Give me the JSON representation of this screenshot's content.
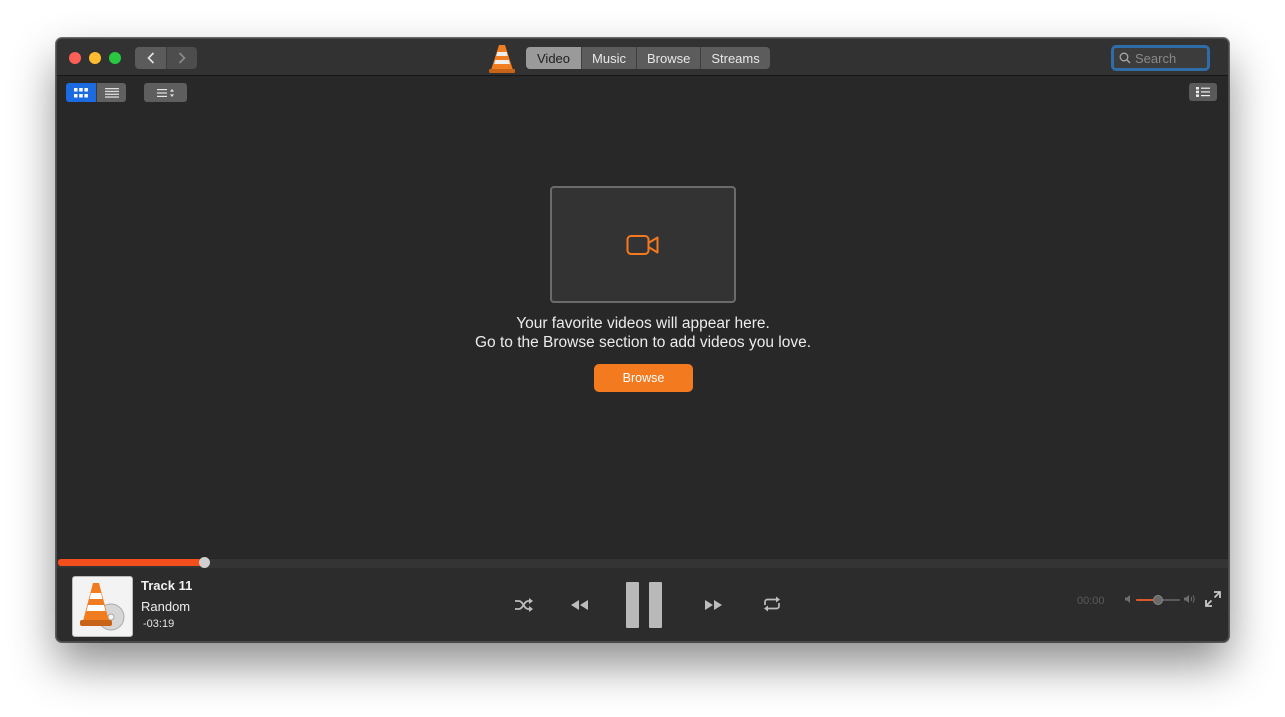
{
  "titlebar": {
    "tabs": [
      {
        "label": "Video",
        "active": true
      },
      {
        "label": "Music",
        "active": false
      },
      {
        "label": "Browse",
        "active": false
      },
      {
        "label": "Streams",
        "active": false
      }
    ],
    "search_placeholder": "Search"
  },
  "library": {
    "view_mode": "grid",
    "empty_message_line1": "Your favorite videos will appear here.",
    "empty_message_line2": "Go to the Browse section to add videos you love.",
    "browse_button_label": "Browse",
    "placeholder_icon": "video-camera-icon"
  },
  "player": {
    "track_title": "Track 11",
    "artist": "Random",
    "remaining_time": "-03:19",
    "elapsed_time": "00:00",
    "progress_fraction": 0.125,
    "volume_fraction": 0.5,
    "state": "playing"
  },
  "colors": {
    "accent": "#f47a1f",
    "progress": "#f24f1d",
    "selection": "#1d6be0",
    "background": "#282828"
  }
}
